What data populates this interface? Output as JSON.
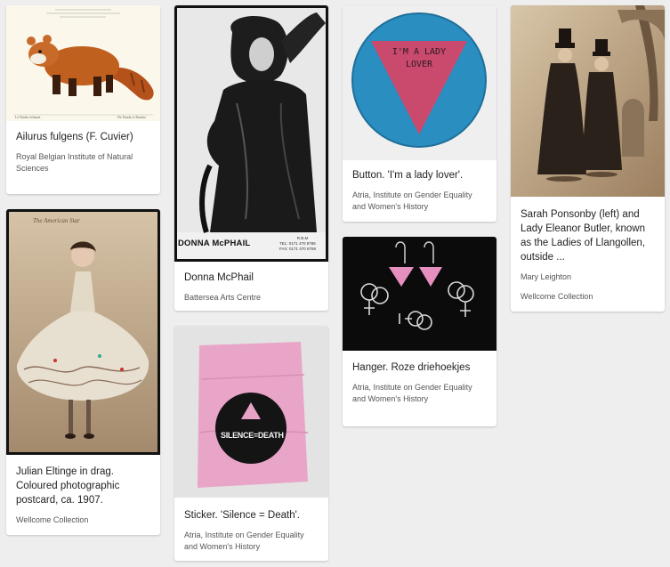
{
  "cards": [
    {
      "title": "Ailurus fulgens (F. Cuvier)",
      "source": "Royal Belgian Institute of Natural Sciences",
      "image": "red-panda-illustration"
    },
    {
      "title": "Julian Eltinge in drag. Coloured photographic postcard, ca. 1907.",
      "source": "Wellcome Collection",
      "image": "dancer-postcard"
    },
    {
      "title": "Donna McPhail",
      "source": "Battersea Arts Centre",
      "image": "portrait-photo",
      "photo_caption": "DONNA McPHAIL",
      "photo_small_text": [
        "R.B.M",
        "TEL: 0171 470 8786",
        "FAX: 0171 470 8769"
      ]
    },
    {
      "title": "Sticker. 'Silence = Death'.",
      "source": "Atria, Institute on Gender Equality and Women's History",
      "image": "silence-death-sticker",
      "sticker_text": "SILENCE=DEATH"
    },
    {
      "title": "Button. 'I'm a lady lover'.",
      "source": "Atria, Institute on Gender Equality and Women's History",
      "image": "lady-lover-button",
      "button_text": [
        "I'M A LADY",
        "LOVER"
      ]
    },
    {
      "title": "Hanger. Roze driehoekjes",
      "source": "Atria, Institute on Gender Equality and Women's History",
      "image": "pink-triangle-earrings"
    },
    {
      "title": "Sarah Ponsonby (left) and Lady Eleanor Butler, known as the Ladies of Llangollen, outside ...",
      "source_author": "Mary Leighton",
      "source": "Wellcome Collection",
      "image": "ladies-of-llangollen-engraving"
    }
  ]
}
